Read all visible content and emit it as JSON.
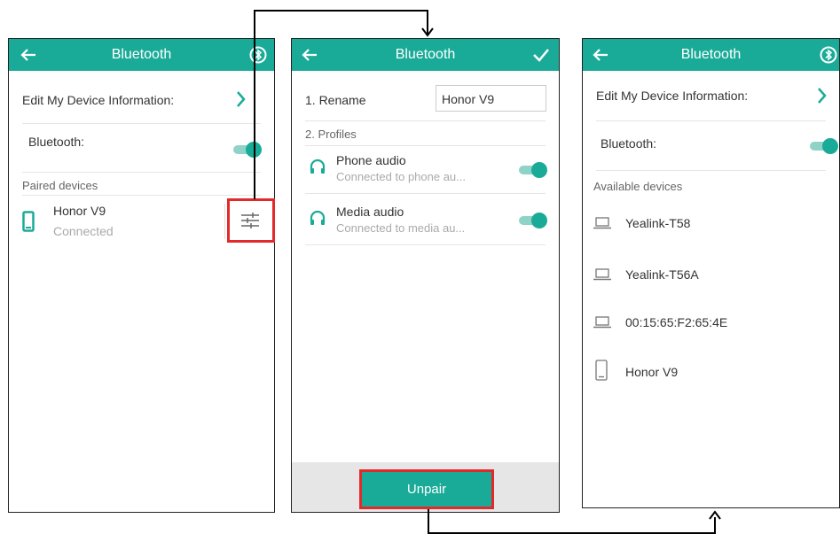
{
  "left_screen": {
    "title": "Bluetooth",
    "edit_label": "Edit My Device Information:",
    "bluetooth_label": "Bluetooth:",
    "bluetooth_on": true,
    "paired_header": "Paired devices",
    "device_name": "Honor V9",
    "device_status": "Connected"
  },
  "middle_screen": {
    "title": "Bluetooth",
    "rename_label": "1. Rename",
    "rename_value": "Honor V9",
    "profiles_header": "2. Profiles",
    "profiles": [
      {
        "name": "Phone audio",
        "desc": "Connected to phone au...",
        "on": true
      },
      {
        "name": "Media audio",
        "desc": "Connected to media au...",
        "on": true
      }
    ],
    "unpair_label": "Unpair"
  },
  "right_screen": {
    "title": "Bluetooth",
    "edit_label": "Edit My Device Information:",
    "bluetooth_label": "Bluetooth:",
    "bluetooth_on": true,
    "available_header": "Available devices",
    "devices": [
      {
        "name": "Yealink-T58",
        "icon": "laptop-icon"
      },
      {
        "name": "Yealink-T56A",
        "icon": "laptop-icon"
      },
      {
        "name": "00:15:65:F2:65:4E",
        "icon": "laptop-icon"
      },
      {
        "name": "Honor V9",
        "icon": "phone-icon"
      }
    ]
  },
  "colors": {
    "accent": "#1aab98",
    "highlight": "#e32a2a"
  }
}
